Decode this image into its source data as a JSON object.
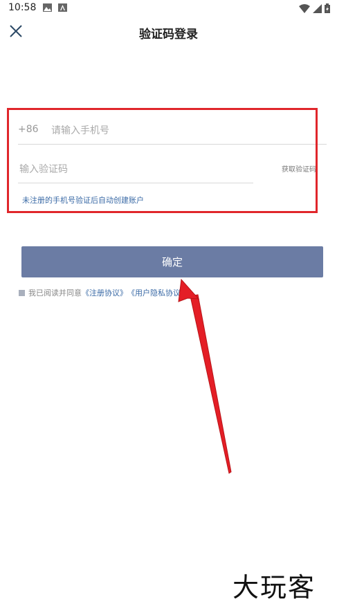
{
  "status_bar": {
    "time": "10:58"
  },
  "header": {
    "title": "验证码登录"
  },
  "form": {
    "country_code": "+86",
    "phone_placeholder": "请输入手机号",
    "code_placeholder": "输入验证码",
    "get_code_label": "获取验证码",
    "hint": "未注册的手机号验证后自动创建账户"
  },
  "confirm_label": "确定",
  "agreement": {
    "prefix": "我已阅读并同意",
    "terms": "《注册协议》",
    "privacy": "《用户隐私协议》"
  },
  "colors": {
    "highlight": "#e0262b",
    "button": "#6b7ca4",
    "link": "#3a6aa6"
  }
}
